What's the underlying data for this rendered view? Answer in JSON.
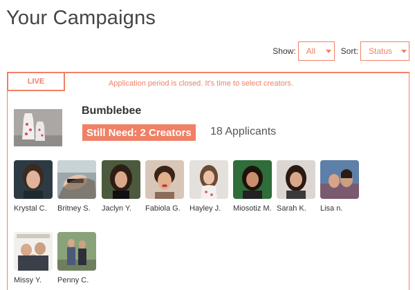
{
  "page": {
    "title": "Your Campaigns"
  },
  "filters": {
    "show_label": "Show:",
    "show_value": "All",
    "sort_label": "Sort:",
    "sort_value": "Status"
  },
  "campaign": {
    "status_badge": "LIVE",
    "notice": "Application period is closed. It's time to select creators.",
    "name": "Bumblebee",
    "need_badge": "Still Need: 2 Creators",
    "applicants": "18 Applicants",
    "creators": [
      {
        "name": "Krystal C."
      },
      {
        "name": "Britney S."
      },
      {
        "name": "Jaclyn Y."
      },
      {
        "name": "Fabiola G."
      },
      {
        "name": "Hayley J."
      },
      {
        "name": "Miosotiz M."
      },
      {
        "name": "Sarah K."
      },
      {
        "name": "Lisa n."
      },
      {
        "name": "Missy Y."
      },
      {
        "name": "Penny C."
      }
    ]
  },
  "colors": {
    "accent": "#f08066",
    "text": "#333333"
  }
}
